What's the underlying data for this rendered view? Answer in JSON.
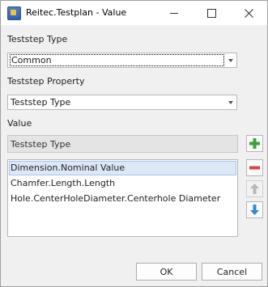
{
  "window": {
    "title": "Reitec.Testplan - Value"
  },
  "teststep_type": {
    "label": "Teststep Type",
    "selected": "Common"
  },
  "teststep_property": {
    "label": "Teststep Property",
    "selected": "Teststep Type"
  },
  "value": {
    "label": "Value",
    "current": "Teststep Type",
    "items": [
      "Dimension.Nominal Value",
      "Chamfer.Length.Length",
      "Hole.CenterHoleDiameter.Centerhole Diameter"
    ],
    "selected_index": 0
  },
  "side_buttons": {
    "add_icon": "plus-icon",
    "remove_icon": "minus-icon",
    "up_icon": "arrow-up-icon",
    "down_icon": "arrow-down-icon"
  },
  "buttons": {
    "ok": "OK",
    "cancel": "Cancel"
  },
  "colors": {
    "add": "#3aa13a",
    "remove": "#d9433d",
    "down": "#2f8bd6",
    "disabled": "#b8b8b8"
  }
}
